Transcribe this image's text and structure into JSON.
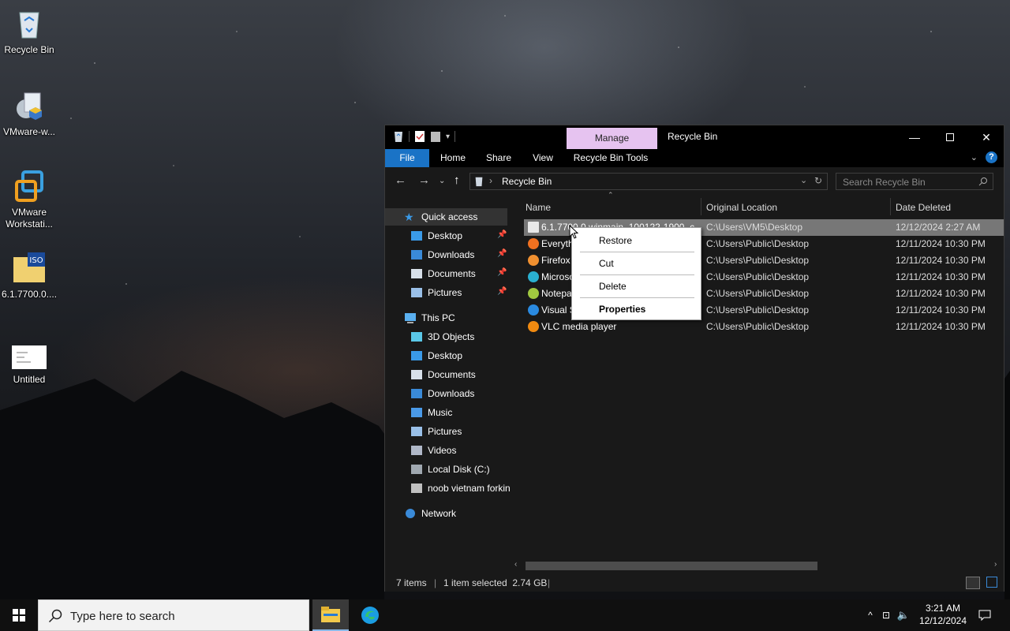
{
  "desktop": {
    "icons": [
      {
        "label": "Recycle Bin",
        "icon": "recycle-bin-icon"
      },
      {
        "label": "VMware-w...",
        "icon": "installer-icon"
      },
      {
        "label": "VMware Workstati...",
        "icon": "vmware-icon"
      },
      {
        "label": "6.1.7700.0....",
        "icon": "iso-icon"
      },
      {
        "label": "Untitled",
        "icon": "image-thumbnail-icon"
      }
    ]
  },
  "window": {
    "manage_tab": "Manage",
    "title": "Recycle Bin",
    "ribbon_tabs": {
      "file": "File",
      "home": "Home",
      "share": "Share",
      "view": "View",
      "tools": "Recycle Bin Tools"
    },
    "help": "?",
    "address": {
      "crumb": "Recycle Bin"
    },
    "search": {
      "placeholder": "Search Recycle Bin"
    },
    "sidebar": {
      "quick_access": "Quick access",
      "qa_items": [
        "Desktop",
        "Downloads",
        "Documents",
        "Pictures"
      ],
      "this_pc": "This PC",
      "pc_items": [
        "3D Objects",
        "Desktop",
        "Documents",
        "Downloads",
        "Music",
        "Pictures",
        "Videos",
        "Local Disk (C:)",
        "noob vietnam forkin"
      ],
      "network": "Network"
    },
    "columns": {
      "name": "Name",
      "location": "Original Location",
      "date": "Date Deleted"
    },
    "files": [
      {
        "name": "6.1.7700.0.winmain_100122-1900_c...",
        "location": "C:\\Users\\VM5\\Desktop",
        "date": "12/12/2024 2:27 AM"
      },
      {
        "name": "Everything",
        "location": "C:\\Users\\Public\\Desktop",
        "date": "12/11/2024 10:30 PM"
      },
      {
        "name": "Firefox",
        "location": "C:\\Users\\Public\\Desktop",
        "date": "12/11/2024 10:30 PM"
      },
      {
        "name": "Microsoft Edge",
        "location": "C:\\Users\\Public\\Desktop",
        "date": "12/11/2024 10:30 PM"
      },
      {
        "name": "Notepad++",
        "location": "C:\\Users\\Public\\Desktop",
        "date": "12/11/2024 10:30 PM"
      },
      {
        "name": "Visual Studio Code",
        "location": "C:\\Users\\Public\\Desktop",
        "date": "12/11/2024 10:30 PM"
      },
      {
        "name": "VLC media player",
        "location": "C:\\Users\\Public\\Desktop",
        "date": "12/11/2024 10:30 PM"
      }
    ],
    "status": {
      "count": "7 items",
      "selection": "1 item selected  2.74 GB"
    }
  },
  "context_menu": {
    "restore": "Restore",
    "cut": "Cut",
    "delete": "Delete",
    "properties": "Properties"
  },
  "taskbar": {
    "search_placeholder": "Type here to search",
    "time": "3:21 AM",
    "date": "12/12/2024"
  },
  "colors": {
    "accent": "#1a73c6",
    "manage": "#e6c3f0",
    "selected_row": "#777777"
  }
}
